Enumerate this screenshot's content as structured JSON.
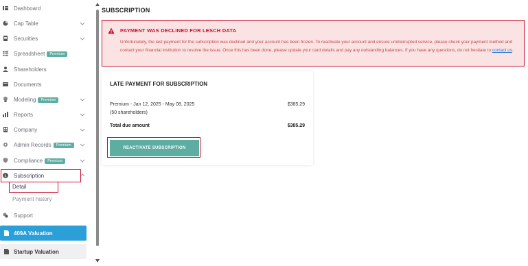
{
  "sidebar": {
    "items": [
      {
        "label": "Dashboard",
        "icon": "dashboard-icon"
      },
      {
        "label": "Cap Table",
        "icon": "pie-chart-icon"
      },
      {
        "label": "Securities",
        "icon": "document-icon"
      },
      {
        "label": "Spreadsheet",
        "icon": "grid-icon",
        "badge": "Premium"
      },
      {
        "label": "Shareholders",
        "icon": "person-icon"
      },
      {
        "label": "Documents",
        "icon": "folder-icon"
      },
      {
        "label": "Modeling",
        "icon": "bulb-icon",
        "badge": "Premium"
      },
      {
        "label": "Reports",
        "icon": "chart-icon"
      },
      {
        "label": "Company",
        "icon": "building-icon"
      },
      {
        "label": "Admin Records",
        "icon": "gear-icon",
        "badge": "Premium"
      },
      {
        "label": "Compliance",
        "icon": "shield-icon",
        "badge": "Premium"
      },
      {
        "label": "Subscription",
        "icon": "money-icon"
      }
    ],
    "subscription_sub": [
      {
        "label": "Detail"
      },
      {
        "label": "Payment history"
      }
    ],
    "support": {
      "label": "Support",
      "icon": "support-icon"
    },
    "valuation_409a": {
      "label": "409A Valuation",
      "icon": "document-icon"
    },
    "startup_valuation": {
      "label": "Startup Valuation",
      "icon": "document-icon"
    }
  },
  "main": {
    "page_title": "SUBSCRIPTION",
    "alert": {
      "title": "PAYMENT WAS DECLINED FOR LESCH DATA",
      "body": "Unfortunately, the last payment for the subscription was declined and your account has been frozen. To reactivate your account and ensure uninterrupted service, please check your payment method and contact your financial institution to resolve the issue. Once this has been done, please update your card details and pay any outstanding balances. If you have any questions, do not hesitate to",
      "link": "contact us",
      "tail": "."
    },
    "card": {
      "title": "LATE PAYMENT FOR SUBSCRIPTION",
      "line1": "Premium - Jan 12, 2025 - May 08, 2025",
      "line2": "(50 shareholders)",
      "amount": "$385.29",
      "total_label": "Total due amount",
      "total_amount": "$385.29",
      "button": "REACTIVATE SUBSCRIPTION"
    }
  },
  "colors": {
    "accent": "#5dada2",
    "alert_red": "#c8102e",
    "alert_bg": "#fbe3e3",
    "valuation_blue": "#2b9fd8"
  }
}
